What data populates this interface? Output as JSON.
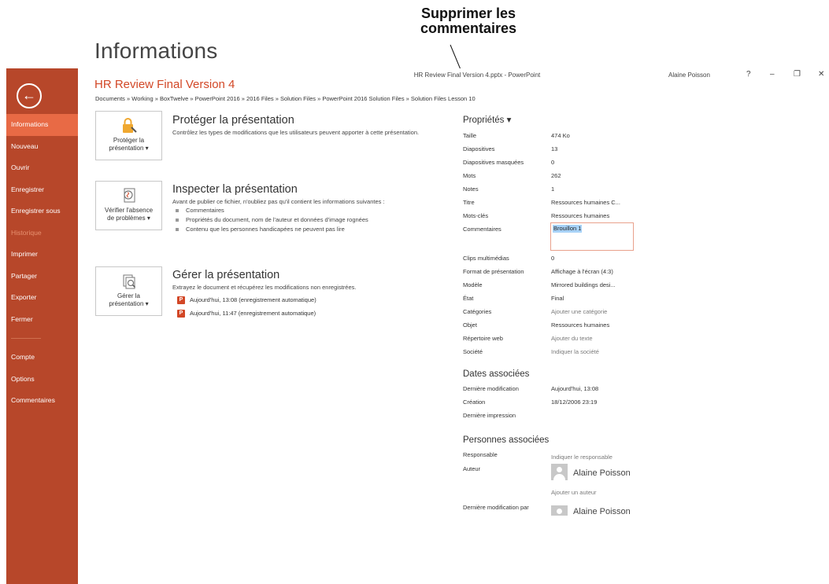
{
  "annotation": {
    "line1": "Supprimer les",
    "line2": "commentaires"
  },
  "window": {
    "title": "HR Review Final Version 4.pptx - PowerPoint",
    "user": "Alaine Poisson",
    "help": "?",
    "minimize": "–",
    "restore": "❐",
    "close": "✕"
  },
  "sidebar": {
    "back": "←",
    "items": [
      {
        "label": "Informations"
      },
      {
        "label": "Nouveau"
      },
      {
        "label": "Ouvrir"
      },
      {
        "label": "Enregistrer"
      },
      {
        "label": "Enregistrer sous"
      },
      {
        "label": "Historique"
      },
      {
        "label": "Imprimer"
      },
      {
        "label": "Partager"
      },
      {
        "label": "Exporter"
      },
      {
        "label": "Fermer"
      },
      {
        "label": "Compte"
      },
      {
        "label": "Options"
      },
      {
        "label": "Commentaires"
      }
    ]
  },
  "page": {
    "heading": "Informations",
    "file_name": "HR Review Final Version 4",
    "path": "Documents » Working » BoxTwelve » PowerPoint 2016 » 2016 Files » Solution Files » PowerPoint 2016 Solution Files » Solution Files Lesson 10"
  },
  "protect": {
    "tile_line1": "Protéger la",
    "tile_line2": "présentation ▾",
    "heading": "Protéger la présentation",
    "desc": "Contrôlez les types de modifications que les utilisateurs peuvent apporter à cette présentation."
  },
  "inspect": {
    "tile_line1": "Vérifier l'absence",
    "tile_line2": "de problèmes ▾",
    "heading": "Inspecter la présentation",
    "desc": "Avant de publier ce fichier, n'oubliez pas qu'il contient les informations suivantes :",
    "bullets": [
      "Commentaires",
      "Propriétés du document, nom de l'auteur et données d'image rognées",
      "Contenu que les personnes handicapées ne peuvent pas lire"
    ]
  },
  "manage": {
    "tile_line1": "Gérer la",
    "tile_line2": "présentation ▾",
    "heading": "Gérer la présentation",
    "desc": "Extrayez le document et récupérez les modifications non enregistrées.",
    "versions": [
      "Aujourd'hui, 13:08 (enregistrement automatique)",
      "Aujourd'hui, 11:47 (enregistrement automatique)"
    ]
  },
  "properties": {
    "heading": "Propriétés ▾",
    "rows": [
      {
        "label": "Taille",
        "value": "474 Ko"
      },
      {
        "label": "Diapositives",
        "value": "13"
      },
      {
        "label": "Diapositives masquées",
        "value": "0"
      },
      {
        "label": "Mots",
        "value": "262"
      },
      {
        "label": "Notes",
        "value": "1"
      },
      {
        "label": "Titre",
        "value": "Ressources humaines C..."
      },
      {
        "label": "Mots-clés",
        "value": "Ressources humaines"
      }
    ],
    "comments_label": "Commentaires",
    "comments_value": "Brouillon 1",
    "rows2": [
      {
        "label": "Clips multimédias",
        "value": "0"
      },
      {
        "label": "Format de présentation",
        "value": "Affichage à l'écran (4:3)"
      },
      {
        "label": "Modèle",
        "value": "Mirrored buildings desi..."
      },
      {
        "label": "État",
        "value": "Final"
      },
      {
        "label": "Catégories",
        "value": "Ajouter une catégorie"
      },
      {
        "label": "Objet",
        "value": "Ressources humaines"
      },
      {
        "label": "Répertoire web",
        "value": "Ajouter du texte"
      },
      {
        "label": "Société",
        "value": "Indiquer la société"
      }
    ]
  },
  "dates": {
    "heading": "Dates associées",
    "rows": [
      {
        "label": "Dernière modification",
        "value": "Aujourd'hui, 13:08"
      },
      {
        "label": "Création",
        "value": "18/12/2006 23:19"
      },
      {
        "label": "Dernière impression",
        "value": ""
      }
    ]
  },
  "people": {
    "heading": "Personnes associées",
    "manager_label": "Responsable",
    "manager_value": "Indiquer le responsable",
    "author_label": "Auteur",
    "author_name": "Alaine Poisson",
    "add_author": "Ajouter un auteur",
    "last_modified_label": "Dernière modification par",
    "last_modified_name": "Alaine Poisson"
  }
}
